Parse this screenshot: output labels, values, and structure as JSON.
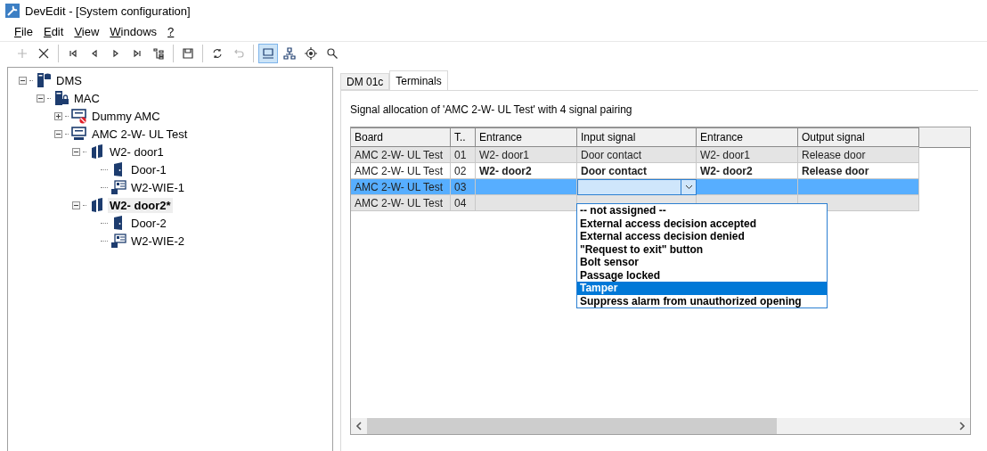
{
  "window": {
    "title": "DevEdit - [System configuration]"
  },
  "menu": [
    "File",
    "Edit",
    "View",
    "Windows",
    "?"
  ],
  "toolbar": [
    {
      "kind": "add",
      "disabled": true
    },
    {
      "kind": "delete",
      "disabled": false
    },
    {
      "kind": "separator"
    },
    {
      "kind": "first",
      "disabled": false
    },
    {
      "kind": "prev",
      "disabled": false
    },
    {
      "kind": "next",
      "disabled": false
    },
    {
      "kind": "last",
      "disabled": false
    },
    {
      "kind": "tree",
      "disabled": false
    },
    {
      "kind": "separator"
    },
    {
      "kind": "save",
      "disabled": false
    },
    {
      "kind": "separator"
    },
    {
      "kind": "refresh",
      "disabled": false
    },
    {
      "kind": "undo",
      "disabled": true
    },
    {
      "kind": "separator"
    },
    {
      "kind": "device",
      "disabled": false,
      "pressed": true
    },
    {
      "kind": "network",
      "disabled": false,
      "pressed": false
    },
    {
      "kind": "target",
      "disabled": false,
      "pressed": false
    },
    {
      "kind": "search",
      "disabled": false,
      "pressed": false
    }
  ],
  "tree": [
    {
      "label": "DMS",
      "kind": "server",
      "expanded": true,
      "selected": false,
      "children": [
        {
          "label": "MAC",
          "kind": "controller",
          "expanded": true,
          "selected": false,
          "children": [
            {
              "label": "Dummy AMC",
              "kind": "amc-blocked",
              "expanded": false,
              "selected": false
            },
            {
              "label": "AMC 2-W- UL Test",
              "kind": "amc",
              "expanded": true,
              "selected": false,
              "children": [
                {
                  "label": "W2- door1",
                  "kind": "entrance",
                  "expanded": true,
                  "selected": false,
                  "children": [
                    {
                      "label": "Door-1",
                      "kind": "door",
                      "selected": false
                    },
                    {
                      "label": "W2-WIE-1",
                      "kind": "reader",
                      "selected": false
                    }
                  ]
                },
                {
                  "label": "W2- door2*",
                  "kind": "entrance",
                  "expanded": true,
                  "selected": true,
                  "children": [
                    {
                      "label": "Door-2",
                      "kind": "door",
                      "selected": false
                    },
                    {
                      "label": "W2-WIE-2",
                      "kind": "reader",
                      "selected": false
                    }
                  ]
                }
              ]
            }
          ]
        }
      ]
    }
  ],
  "tabs": [
    {
      "label": "DM 01c",
      "selected": false
    },
    {
      "label": "Terminals",
      "selected": true
    }
  ],
  "caption": "Signal allocation of 'AMC 2-W- UL Test' with 4 signal pairing",
  "table": {
    "columns": [
      "Board",
      "T..",
      "Entrance",
      "Input signal",
      "Entrance",
      "Output signal"
    ],
    "rows": [
      {
        "cells": [
          "AMC 2-W- UL Test",
          "01",
          "W2- door1",
          "Door contact",
          "W2- door1",
          "Release door"
        ],
        "selected": false,
        "modified": false
      },
      {
        "cells": [
          "AMC 2-W- UL Test",
          "02",
          "W2- door2",
          "Door contact",
          "W2- door2",
          "Release door"
        ],
        "selected": false,
        "modified": true
      },
      {
        "cells": [
          "AMC 2-W- UL Test",
          "03",
          "",
          "",
          "",
          ""
        ],
        "selected": true,
        "modified": false,
        "editing": true
      },
      {
        "cells": [
          "AMC 2-W- UL Test",
          "04",
          "",
          "",
          "",
          ""
        ],
        "selected": false,
        "modified": false
      }
    ]
  },
  "dropdown": {
    "expanded": true,
    "options": [
      {
        "label": "-- not assigned --",
        "selected": false
      },
      {
        "label": "External access decision accepted",
        "selected": false
      },
      {
        "label": "External access decision denied",
        "selected": false
      },
      {
        "label": "\"Request to exit\" button",
        "selected": false
      },
      {
        "label": "Bolt sensor",
        "selected": false
      },
      {
        "label": "Passage locked",
        "selected": false
      },
      {
        "label": "Tamper",
        "selected": true
      },
      {
        "label": "Suppress alarm from unauthorized opening",
        "selected": false
      }
    ]
  }
}
